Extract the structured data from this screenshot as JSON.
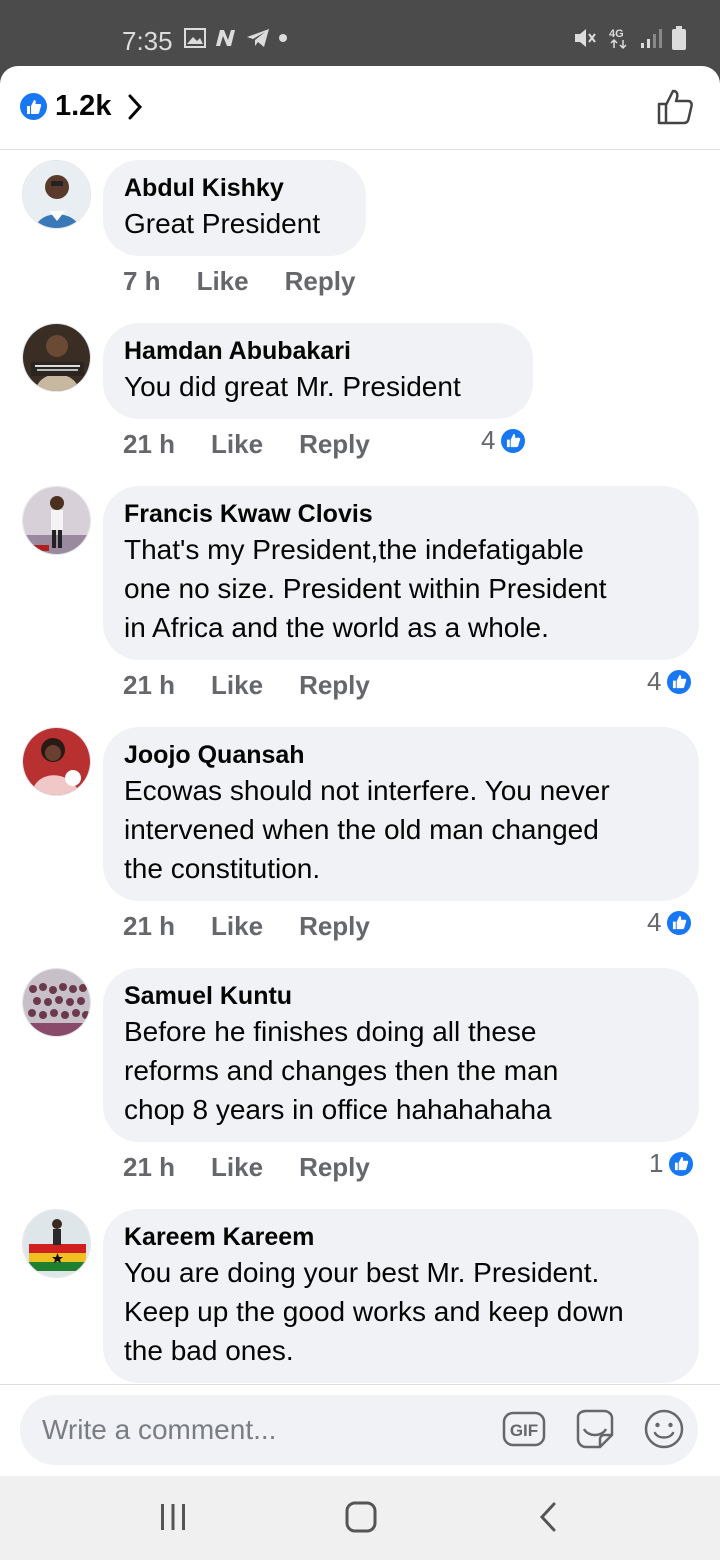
{
  "status_bar": {
    "time": "7:35",
    "network": "4G"
  },
  "header": {
    "reaction_count": "1.2k"
  },
  "comments": [
    {
      "author": "Abdul Kishky",
      "text": "Great President",
      "time": "7 h",
      "like_label": "Like",
      "reply_label": "Reply",
      "reactions": ""
    },
    {
      "author": "Hamdan Abubakari",
      "text": "You did great Mr. President",
      "time": "21 h",
      "like_label": "Like",
      "reply_label": "Reply",
      "reactions": "4"
    },
    {
      "author": "Francis Kwaw Clovis",
      "text": "That's my President,the indefatigable\none no size. President within President\nin Africa and the world as a whole.",
      "time": "21 h",
      "like_label": "Like",
      "reply_label": "Reply",
      "reactions": "4"
    },
    {
      "author": "Joojo Quansah",
      "text": "Ecowas should not interfere. You never\nintervened when the old man changed\nthe constitution.",
      "time": "21 h",
      "like_label": "Like",
      "reply_label": "Reply",
      "reactions": "4"
    },
    {
      "author": "Samuel Kuntu",
      "text": "Before he finishes doing all these\nreforms and changes then the man\nchop 8 years in office hahahahaha",
      "time": "21 h",
      "like_label": "Like",
      "reply_label": "Reply",
      "reactions": "1"
    },
    {
      "author": "Kareem Kareem",
      "text": "You are doing your best Mr. President.\nKeep up the good works and keep down\nthe bad ones.",
      "time": "",
      "like_label": "",
      "reply_label": "",
      "reactions": ""
    }
  ],
  "composer": {
    "placeholder": "Write a comment...",
    "gif_label": "GIF",
    "icons": [
      "gif-icon",
      "sticker-icon",
      "emoji-icon"
    ]
  },
  "colors": {
    "accent": "#1877f2",
    "bubble": "#f0f2f5",
    "secondary_text": "#65676b"
  }
}
